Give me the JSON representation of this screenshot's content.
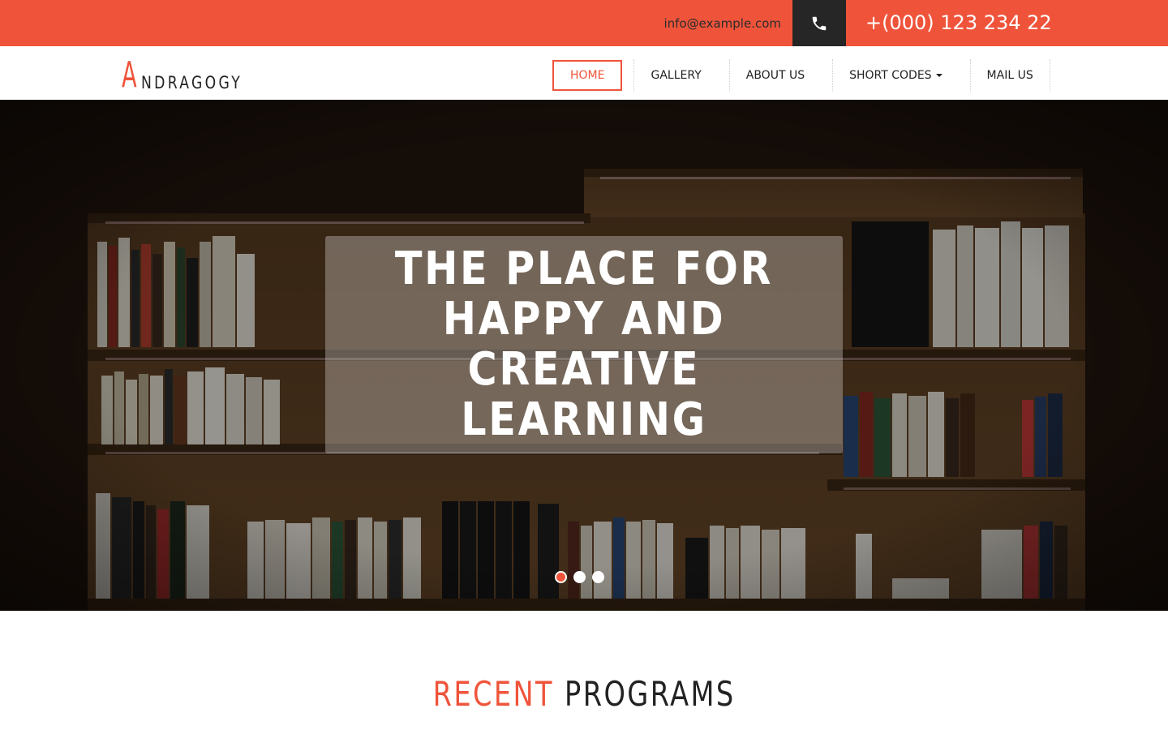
{
  "topbar": {
    "email": "info@example.com",
    "phone_icon": "phone-icon",
    "phone": "+(000) 123 234 22"
  },
  "brand": {
    "initial": "A",
    "rest": "NDRAGOGY"
  },
  "nav": {
    "items": [
      {
        "label": "HOME",
        "active": true
      },
      {
        "label": "GALLERY"
      },
      {
        "label": "ABOUT US"
      },
      {
        "label": "SHORT CODES",
        "has_dropdown": true
      },
      {
        "label": "MAIL US"
      }
    ]
  },
  "hero": {
    "line1": "THE PLACE FOR",
    "line2": "HAPPY AND CREATIVE",
    "line3": "LEARNING",
    "slides": 3,
    "active_slide": 1
  },
  "section": {
    "accent": "RECENT",
    "main": "PROGRAMS"
  },
  "colors": {
    "accent": "#ef543b",
    "dark": "#262626"
  }
}
